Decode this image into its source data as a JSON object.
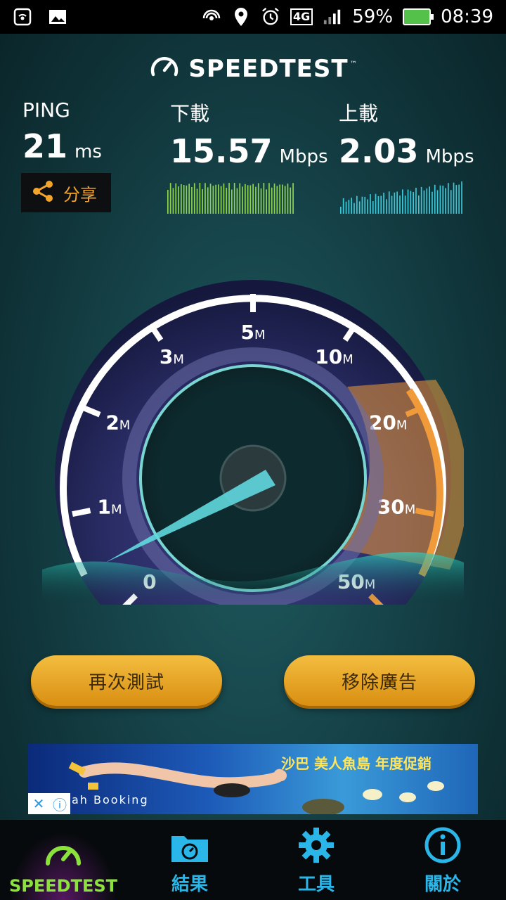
{
  "status_bar": {
    "battery": "59%",
    "time": "08:39",
    "network": "4G",
    "icons": [
      "hotspot-icon",
      "image-icon",
      "wifi-hotspot-icon",
      "location-icon",
      "alarm-icon",
      "network-4g-icon",
      "signal-icon",
      "battery-charging-icon"
    ]
  },
  "header": {
    "logo_text": "SPEEDTEST",
    "trademark": "™"
  },
  "metrics": {
    "ping": {
      "label": "PING",
      "value": "21",
      "unit": "ms"
    },
    "download": {
      "label": "下載",
      "value": "15.57",
      "unit": "Mbps"
    },
    "upload": {
      "label": "上載",
      "value": "2.03",
      "unit": "Mbps"
    }
  },
  "share": {
    "label": "分享"
  },
  "gauge": {
    "ticks": [
      "0",
      "1",
      "2",
      "3",
      "5",
      "10",
      "20",
      "30",
      "50"
    ],
    "unit_suffix": "M",
    "needle_value_mbps": 0,
    "accent": "#f09a3a",
    "ring": "#ffffff"
  },
  "actions": {
    "retest": "再次測試",
    "remove_ads": "移除廣告"
  },
  "ad": {
    "headline": "沙巴 美人魚島 年度促銷",
    "booking": "ah Booking"
  },
  "bottom_nav": [
    {
      "label": "SPEEDTEST",
      "icon": "speedometer-icon",
      "active": true
    },
    {
      "label": "結果",
      "icon": "results-folder-icon",
      "active": false
    },
    {
      "label": "工具",
      "icon": "gear-icon",
      "active": false
    },
    {
      "label": "關於",
      "icon": "info-icon",
      "active": false
    }
  ],
  "colors": {
    "accent_orange": "#f3a42a",
    "nav_active": "#8ce23d",
    "nav_inactive": "#2ab6e8",
    "download_bars": "#8fd44a",
    "upload_bars": "#3cc8d8"
  }
}
